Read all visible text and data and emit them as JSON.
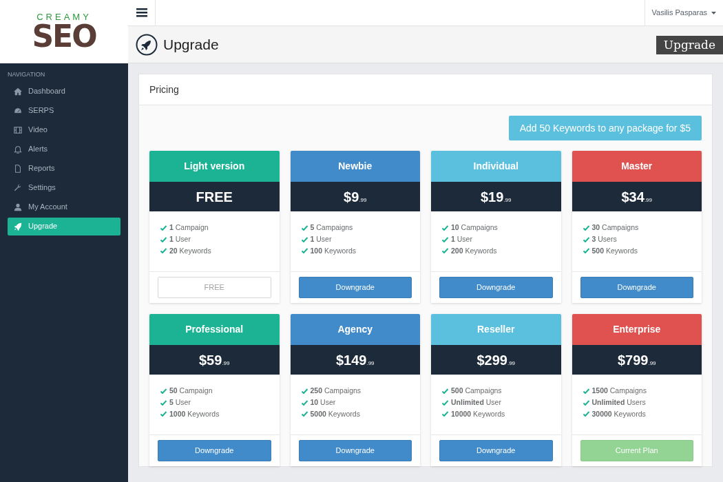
{
  "logo": {
    "top": "CREAMY",
    "main": "SEO"
  },
  "sidebar": {
    "heading": "NAVIGATION",
    "items": [
      {
        "label": "Dashboard",
        "selected": false
      },
      {
        "label": "SERPS",
        "selected": false
      },
      {
        "label": "Video",
        "selected": false
      },
      {
        "label": "Alerts",
        "selected": false
      },
      {
        "label": "Reports",
        "selected": false
      },
      {
        "label": "Settings",
        "selected": false
      },
      {
        "label": "My Account",
        "selected": false
      },
      {
        "label": "Upgrade",
        "selected": true
      }
    ]
  },
  "topbar": {
    "user": "Vasilis Pasparas"
  },
  "page": {
    "title": "Upgrade",
    "badge": "Upgrade"
  },
  "panel": {
    "title": "Pricing",
    "addon_button": "Add 50 Keywords to any package for $5"
  },
  "plans": [
    {
      "name": "Light version",
      "color": "#1bb394",
      "price": "FREE",
      "features": [
        "**1** Campaign",
        "**1** User",
        "**20** Keywords"
      ],
      "button": {
        "label": "FREE",
        "kind": "outline"
      }
    },
    {
      "name": "Newbie",
      "color": "#428bca",
      "price": "$9",
      "cents": ".99",
      "features": [
        "**5** Campaigns",
        "**1** User",
        "**100** Keywords"
      ],
      "button": {
        "label": "Downgrade",
        "kind": "downgrade"
      }
    },
    {
      "name": "Individual",
      "color": "#5bc0de",
      "price": "$19",
      "cents": ".99",
      "features": [
        "**10** Campaigns",
        "**1** User",
        "**200** Keywords"
      ],
      "button": {
        "label": "Downgrade",
        "kind": "downgrade"
      }
    },
    {
      "name": "Master",
      "color": "#e05250",
      "price": "$34",
      "cents": ".99",
      "features": [
        "**30** Campaigns",
        "**3** Users",
        "**500** Keywords"
      ],
      "button": {
        "label": "Downgrade",
        "kind": "downgrade"
      }
    },
    {
      "name": "Professional",
      "color": "#1bb394",
      "price": "$59",
      "cents": ".99",
      "features": [
        "**50** Campaign",
        "**5** User",
        "**1000** Keywords"
      ],
      "button": {
        "label": "Downgrade",
        "kind": "downgrade"
      }
    },
    {
      "name": "Agency",
      "color": "#428bca",
      "price": "$149",
      "cents": ".99",
      "features": [
        "**250** Campaigns",
        "**10** User",
        "**5000** Keywords"
      ],
      "button": {
        "label": "Downgrade",
        "kind": "downgrade"
      }
    },
    {
      "name": "Reseller",
      "color": "#5bc0de",
      "price": "$299",
      "cents": ".99",
      "features": [
        "**500** Campaigns",
        "**Unlimited** User",
        "**10000** Keywords"
      ],
      "button": {
        "label": "Downgrade",
        "kind": "downgrade"
      }
    },
    {
      "name": "Enterprise",
      "color": "#e05250",
      "price": "$799",
      "cents": ".99",
      "features": [
        "**1500** Campaigns",
        "**Unlimited** Users",
        "**30000** Keywords"
      ],
      "button": {
        "label": "Current Plan",
        "kind": "current"
      }
    }
  ]
}
